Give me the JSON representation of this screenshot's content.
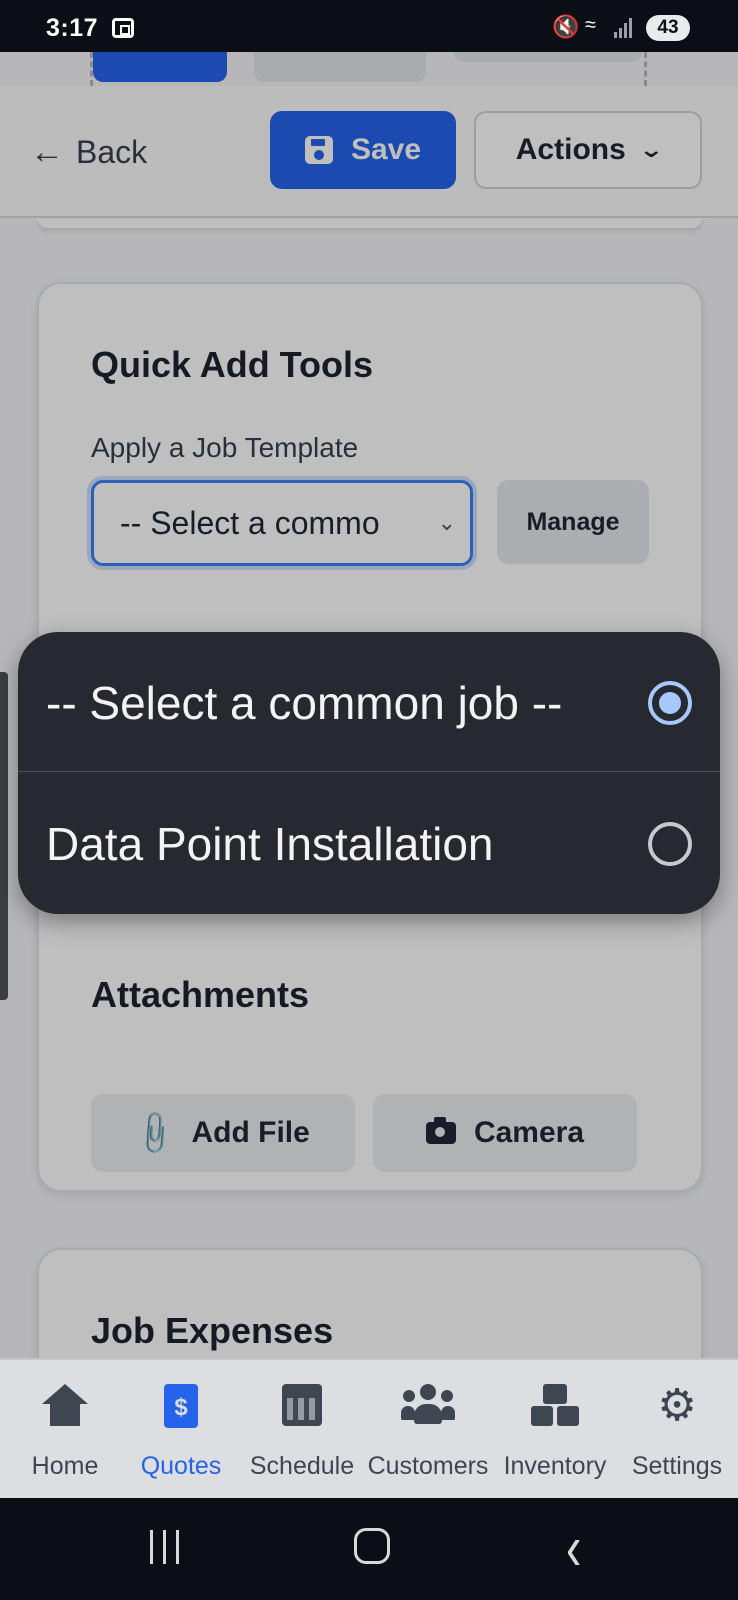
{
  "status_bar": {
    "time": "3:17",
    "battery": "43"
  },
  "toolbar": {
    "back_label": "Back",
    "save_label": "Save",
    "actions_label": "Actions"
  },
  "quick_add": {
    "title": "Quick Add Tools",
    "template_label": "Apply a Job Template",
    "select_value": "-- Select a commo",
    "manage_label": "Manage"
  },
  "attachments": {
    "title": "Attachments",
    "add_file_label": "Add File",
    "camera_label": "Camera"
  },
  "expenses": {
    "title": "Job Expenses"
  },
  "dropdown": {
    "options": [
      {
        "label": "-- Select a common job --",
        "selected": true
      },
      {
        "label": "Data Point Installation",
        "selected": false
      }
    ]
  },
  "bottom_nav": {
    "items": [
      {
        "label": "Home",
        "icon": "home-icon",
        "active": false
      },
      {
        "label": "Quotes",
        "icon": "quote-icon",
        "active": true
      },
      {
        "label": "Schedule",
        "icon": "calendar-icon",
        "active": false
      },
      {
        "label": "Customers",
        "icon": "users-icon",
        "active": false
      },
      {
        "label": "Inventory",
        "icon": "boxes-icon",
        "active": false
      },
      {
        "label": "Settings",
        "icon": "gear-icon",
        "active": false
      }
    ]
  },
  "colors": {
    "primary": "#2563eb",
    "popup_bg": "#26292f",
    "radio_selected": "#a7c8ff"
  }
}
